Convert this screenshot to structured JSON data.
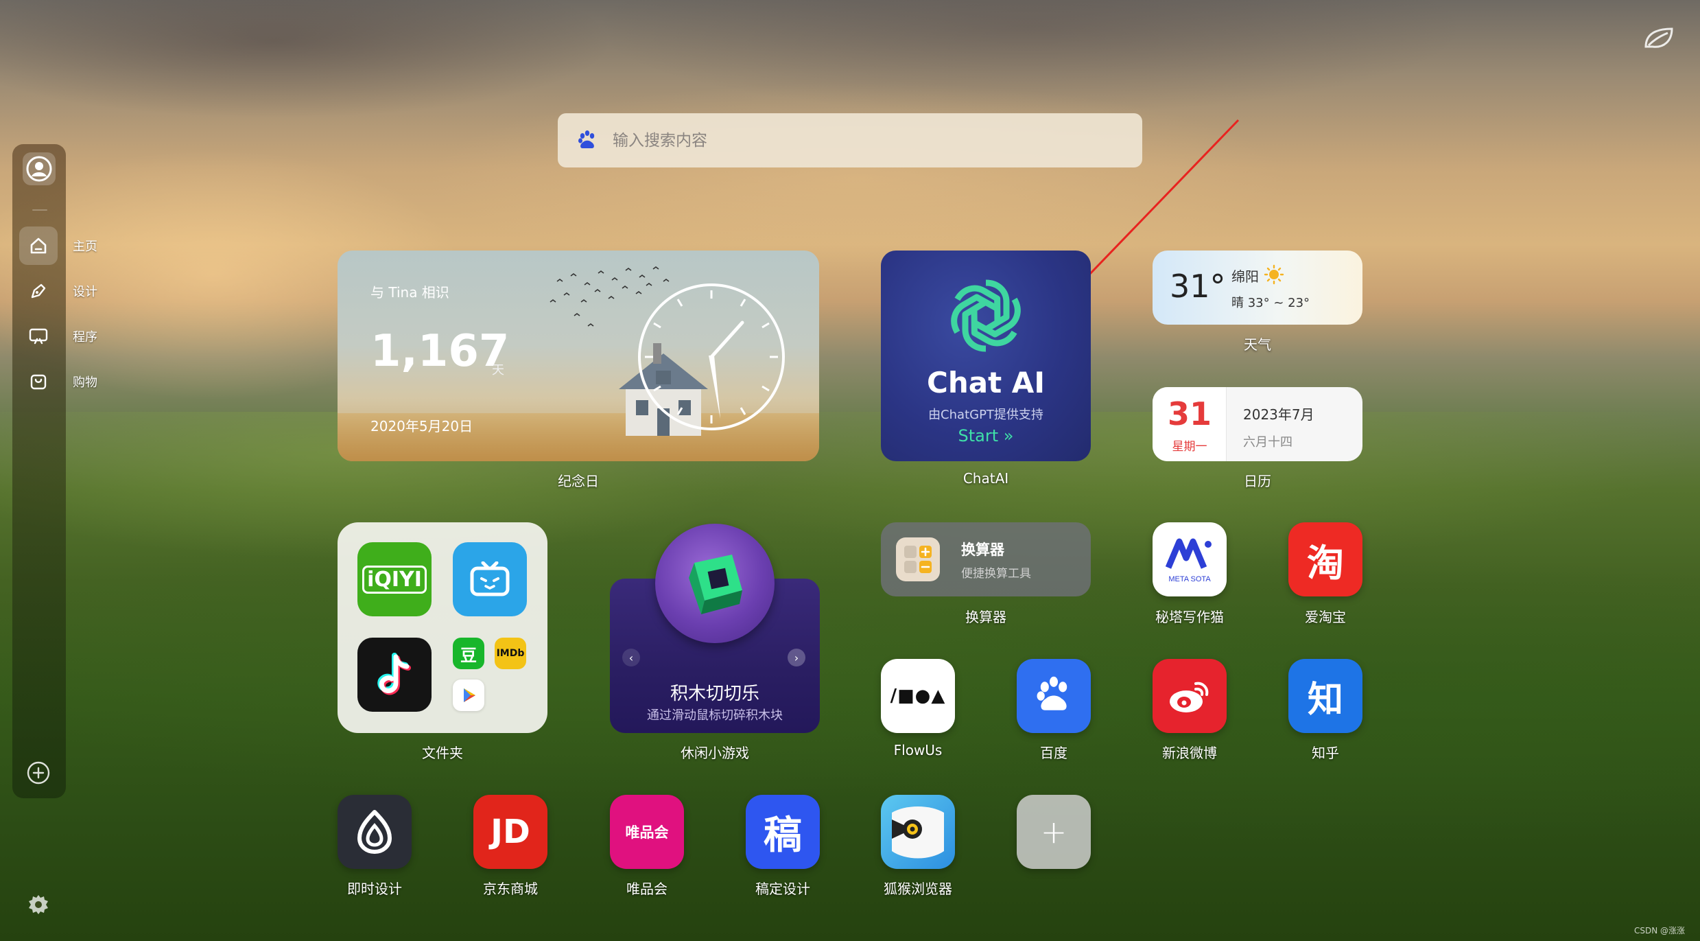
{
  "sidebar": {
    "items": [
      {
        "label": "主页",
        "icon": "home-icon",
        "active": true
      },
      {
        "label": "设计",
        "icon": "pen-icon",
        "active": false
      },
      {
        "label": "程序",
        "icon": "code-icon",
        "active": false
      },
      {
        "label": "购物",
        "icon": "shopping-bag-icon",
        "active": false
      }
    ]
  },
  "search": {
    "placeholder": "输入搜索内容",
    "engine_icon": "baidu-paw-icon"
  },
  "anniversary": {
    "title": "与 Tina 相识",
    "days": "1,167",
    "unit": "天",
    "date": "2020年5月20日",
    "caption": "纪念日"
  },
  "chatai": {
    "title": "Chat AI",
    "subtitle": "由ChatGPT提供支持",
    "start": "Start »",
    "caption": "ChatAI"
  },
  "weather": {
    "temp": "31°",
    "city": "绵阳",
    "range": "晴 33° ~ 23°",
    "caption": "天气"
  },
  "calendar": {
    "day": "31",
    "weekday": "星期一",
    "month": "2023年7月",
    "lunar": "六月十四",
    "caption": "日历"
  },
  "folder": {
    "caption": "文件夹",
    "apps": [
      {
        "name": "iqiyi",
        "glyph": "iQIYI",
        "color": "#3fae1b"
      },
      {
        "name": "bilibili-tv",
        "glyph": "",
        "color": "#2ba5e8"
      },
      {
        "name": "tiktok",
        "glyph": "",
        "color": "#141414"
      },
      {
        "name": "douban",
        "glyph": "豆",
        "color": "#18b62b"
      },
      {
        "name": "imdb",
        "glyph": "IMDb",
        "color": "#f3c316"
      },
      {
        "name": "play",
        "glyph": "",
        "color": "#ffffff"
      }
    ]
  },
  "game": {
    "title": "积木切切乐",
    "subtitle": "通过滑动鼠标切碎积木块",
    "caption": "休闲小游戏",
    "prev": "‹",
    "next": "›"
  },
  "converter": {
    "title": "换算器",
    "subtitle": "便捷换算工具",
    "caption": "换算器"
  },
  "apps": {
    "metasota": {
      "label": "秘塔写作猫",
      "glyph": "META SOTA"
    },
    "taobao": {
      "label": "爱淘宝",
      "glyph": "淘",
      "color": "#ee2a24"
    },
    "flowus": {
      "label": "FlowUs",
      "glyph": "/■●▲"
    },
    "baidu": {
      "label": "百度",
      "color": "#2f6ff0"
    },
    "weibo": {
      "label": "新浪微博",
      "color": "#e6232d"
    },
    "zhihu": {
      "label": "知乎",
      "glyph": "知",
      "color": "#1e74e6"
    },
    "jishi": {
      "label": "即时设计",
      "color": "#2a2d36"
    },
    "jd": {
      "label": "京东商城",
      "glyph": "JD",
      "color": "#e1251b"
    },
    "vip": {
      "label": "唯品会",
      "glyph": "唯品会",
      "color": "#e0117f"
    },
    "gaoding": {
      "label": "稿定设计",
      "glyph": "稿",
      "color": "#2e56f0"
    },
    "hlbrowser": {
      "label": "狐猴浏览器",
      "color": "#3aa7e8"
    },
    "add": {
      "label": "",
      "glyph": "+"
    }
  },
  "footer": {
    "credit": "CSDN @涨涨"
  }
}
